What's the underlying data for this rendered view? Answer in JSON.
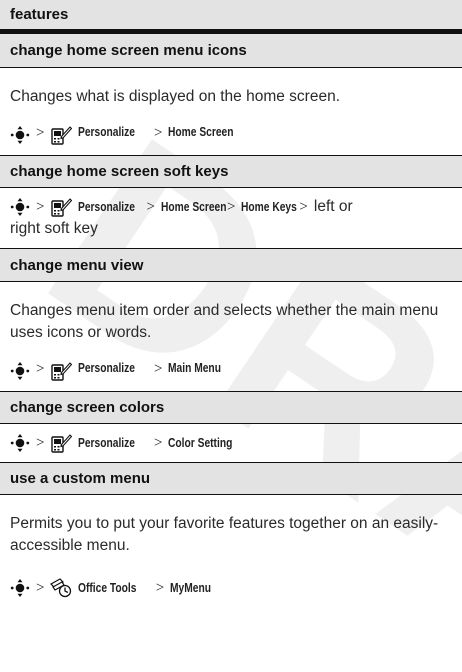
{
  "header": "features",
  "separator": ">",
  "watermark_text": "DRA",
  "icons": {
    "nav_key": "nav-key-icon",
    "personalize": "personalize-icon",
    "office_tools": "office-tools-icon"
  },
  "colors": {
    "header_background": "#e3e3e3",
    "rule": "#111111",
    "watermark": "#efefef"
  },
  "sections": [
    {
      "title": "change home screen menu icons",
      "description": "Changes what is displayed on the home screen.",
      "path": [
        "Personalize",
        "Home Screen"
      ]
    },
    {
      "title": "change home screen soft keys",
      "path": [
        "Personalize",
        "Home Screen",
        "Home Keys"
      ],
      "tail_line1": "left or",
      "tail_line2": "right soft key"
    },
    {
      "title": "change menu view",
      "description": "Changes menu item order and selects whether the main menu uses icons or words.",
      "path": [
        "Personalize",
        "Main Menu"
      ]
    },
    {
      "title": "change screen colors",
      "path": [
        "Personalize",
        "Color Setting"
      ]
    },
    {
      "title": "use a custom menu",
      "description": "Permits you to put your favorite features together on an easily-accessible menu.",
      "path": [
        "Office Tools",
        "MyMenu"
      ]
    }
  ]
}
